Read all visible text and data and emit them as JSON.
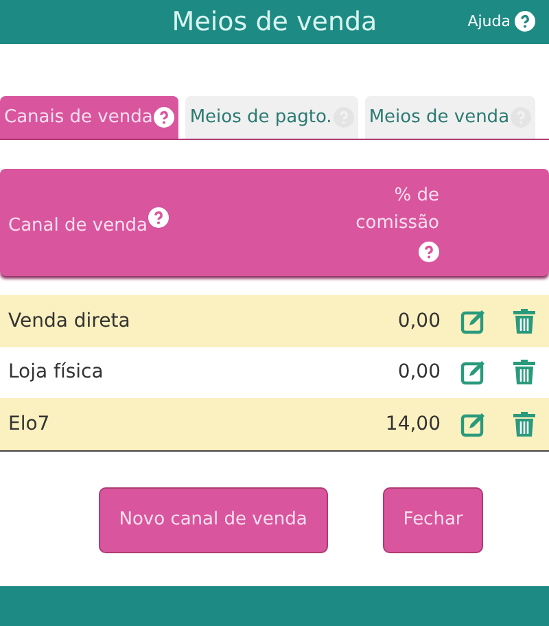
{
  "header": {
    "title": "Meios de venda",
    "help": "Ajuda"
  },
  "tabs": [
    {
      "label": "Canais de venda",
      "selected": true
    },
    {
      "label": "Meios de pagto.",
      "selected": false
    },
    {
      "label": "Meios de venda",
      "selected": false
    }
  ],
  "table": {
    "columns": [
      "Canal de venda",
      "% de comissão"
    ],
    "rows": [
      {
        "name": "Venda direta",
        "commission": "0,00"
      },
      {
        "name": "Loja física",
        "commission": "0,00"
      },
      {
        "name": "Elo7",
        "commission": "14,00"
      }
    ]
  },
  "buttons": [
    "Novo canal de venda",
    "Fechar"
  ]
}
